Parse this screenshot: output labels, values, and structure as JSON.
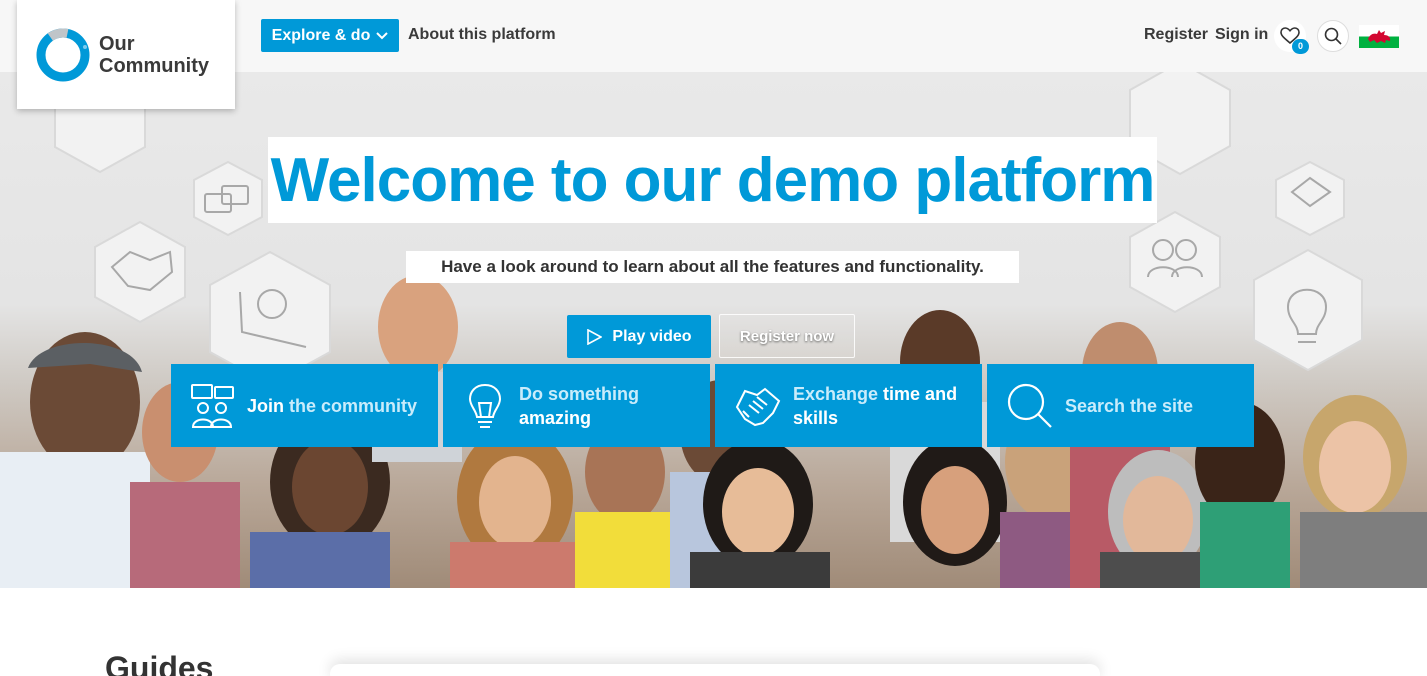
{
  "header": {
    "logo_line1": "Our",
    "logo_line2": "Community",
    "explore_label": "Explore & do",
    "about_label": "About this platform",
    "register_label": "Register",
    "signin_label": "Sign in",
    "favourites_count": "0",
    "language_flag": "welsh-flag-icon"
  },
  "hero": {
    "title": "Welcome to our demo platform",
    "subtitle": "Have a look around to learn about all the features and functionality.",
    "play_label": "Play video",
    "register_label": "Register now",
    "tiles": [
      {
        "part1": "Join",
        "part2": " the community",
        "icon": "community-icon"
      },
      {
        "part1": "Do something ",
        "part2": "amazing",
        "icon": "lightbulb-icon"
      },
      {
        "part1": "Exchange ",
        "part2": "time and skills",
        "icon": "handshake-icon"
      },
      {
        "part1": "Search the site",
        "part2": "",
        "icon": "search-icon"
      }
    ]
  },
  "guides": {
    "title": "Guides"
  },
  "colors": {
    "brand": "#0099d8",
    "header_bg": "#f7f7f7",
    "text": "#333333"
  }
}
